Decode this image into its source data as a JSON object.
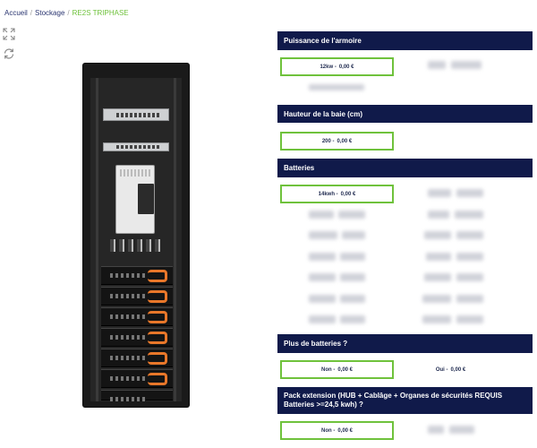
{
  "breadcrumb": {
    "home": "Accueil",
    "category": "Stockage",
    "current": "RE2S TRIPHASE",
    "separator": "/"
  },
  "icons": {
    "expand": "expand-icon",
    "rotate": "rotate-icon"
  },
  "colors": {
    "header_bg": "#101a4a",
    "selected_border": "#6fc23c",
    "breadcrumb_current": "#6fc23c",
    "text_dark": "#1f2a4f"
  },
  "sections": {
    "puissance": {
      "title": "Puissance de l'armoire",
      "selected": {
        "label": "12kw",
        "price": "0,00 €"
      }
    },
    "hauteur": {
      "title": "Hauteur de la baie (cm)",
      "selected": {
        "label": "200",
        "price": "0,00 €"
      }
    },
    "batteries": {
      "title": "Batteries",
      "selected": {
        "label": "14kwh",
        "price": "0,00 €"
      }
    },
    "plus_batteries": {
      "title": "Plus de batteries ?",
      "options": [
        {
          "label": "Non",
          "price": "0,00 €",
          "selected": true
        },
        {
          "label": "Oui",
          "price": "0,00 €",
          "selected": false
        }
      ]
    },
    "pack_extension": {
      "title": "Pack extension (HUB + Cablâge + Organes de sécurités REQUIS Batteries >=24,5 kwh) ?",
      "selected": {
        "label": "Non",
        "price": "0,00 €"
      }
    }
  }
}
